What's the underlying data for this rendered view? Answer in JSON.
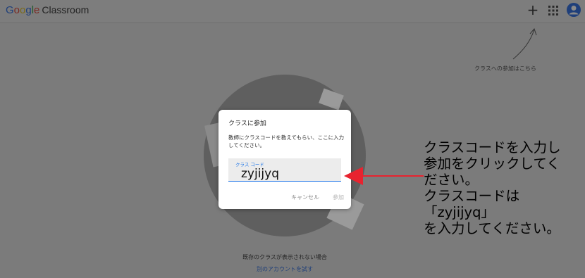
{
  "header": {
    "logo_google": [
      "G",
      "o",
      "o",
      "g",
      "l",
      "e"
    ],
    "logo_product": "Classroom",
    "plus_label": "+"
  },
  "hint": {
    "text": "クラスへの参加はこちら"
  },
  "dialog": {
    "title": "クラスに参加",
    "description": "教師にクラスコードを教えてもらい、ここに入力してください。",
    "field_label": "クラス コード",
    "field_value": "zyjijyq",
    "cancel_label": "キャンセル",
    "join_label": "参加"
  },
  "annotation": {
    "text": "クラスコードを入力し\n参加をクリックしてく\nださい。\nクラスコードは\n「zyjijyq」\nを入力してください。",
    "color": "#e8232f"
  },
  "footer": {
    "note": "既存のクラスが表示されない場合",
    "link": "別のアカウントを試す"
  }
}
